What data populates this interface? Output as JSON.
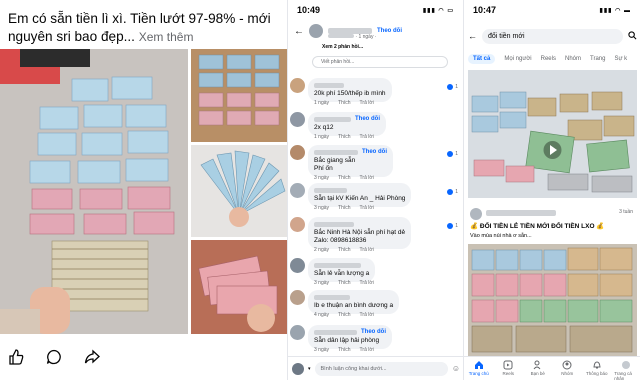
{
  "post": {
    "caption": "Em có sẵn tiền lì xì. Tiền lướt 97-98% - mới nguyên sri bao đẹp...",
    "see_more": "Xem thêm"
  },
  "comments_screen": {
    "time": "10:49",
    "header_follow": "Theo dõi",
    "header_meta": "· 1 ngày ·",
    "prev_reply": "Xem 2 phản hồi...",
    "reply_placeholder": "Viết phản hồi...",
    "like_label": "Thích",
    "reply_label": "Trả lời",
    "follow_label": "Theo dõi",
    "items": [
      {
        "text": "20k phí 150/thếp ib mình",
        "age": "1 ngày",
        "likes": "1",
        "followed": false
      },
      {
        "text": "2x q12",
        "age": "1 ngày",
        "likes": "",
        "followed": true
      },
      {
        "text": "Bắc giang sẵn\nPhí ốn",
        "age": "3 ngày",
        "likes": "1",
        "followed": true
      },
      {
        "text": "Sẵn tại kV Kiến An _ Hải Phòng",
        "age": "3 ngày",
        "likes": "1",
        "followed": false
      },
      {
        "text": "Bắc Ninh Hà Nội sẵn phí hạt dẻ\nZalo: 0898618836",
        "age": "2 ngày",
        "likes": "1",
        "followed": false
      },
      {
        "text": "Sẵn lẻ vẫn lượng a",
        "age": "3 ngày",
        "likes": "",
        "followed": false
      },
      {
        "text": "Ib e thuận an bình dương a",
        "age": "4 ngày",
        "likes": "",
        "followed": false
      },
      {
        "text": "Sẵn dân lập hải phòng",
        "age": "3 ngày",
        "likes": "",
        "followed": true
      }
    ],
    "composer_placeholder": "Bình luận công khai dưới..."
  },
  "search_screen": {
    "time": "10:47",
    "query": "đổi tiền mới",
    "tabs": [
      "Tất cả",
      "Mọi người",
      "Reels",
      "Nhóm",
      "Trang",
      "Sự k"
    ],
    "result2_age": "3 tuần",
    "result2_title": "ĐỔI TIỀN LẺ TIỀN MỚI ĐỔI TIỀN LXO",
    "result2_sub": "Vào mùa núi nhà ơ sẵn...",
    "nav": [
      "Trang chủ",
      "Reels",
      "Bạn bè",
      "Nhóm",
      "Thông báo",
      "Trang cá nhân"
    ]
  },
  "colors": {
    "fb_blue": "#0866ff",
    "bubble": "#f0f2f5",
    "muted": "#65676b"
  }
}
